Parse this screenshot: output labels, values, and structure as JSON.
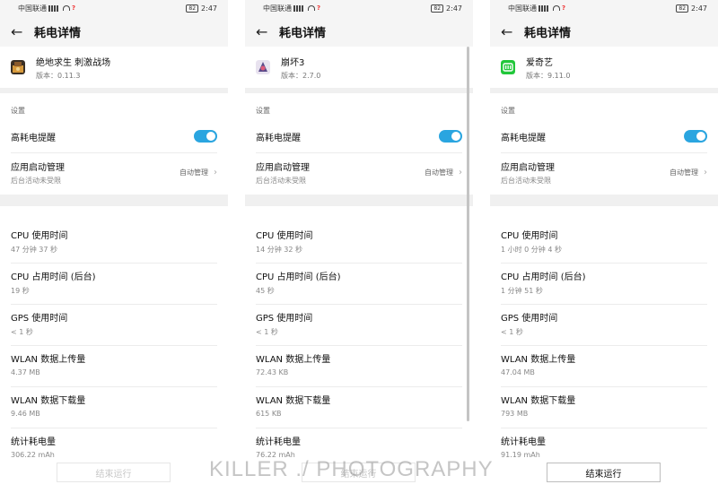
{
  "status_bar": {
    "carrier": "中国联通",
    "alert": "?",
    "battery": "82",
    "time": "2:47"
  },
  "header": {
    "title": "耗电详情"
  },
  "settings": {
    "section_label": "设置",
    "high_power_alert_label": "高耗电提醒",
    "high_power_alert_on": true,
    "launch_mgmt_label": "应用启动管理",
    "launch_mgmt_sub": "后台活动未受限",
    "launch_mgmt_value": "自动管理"
  },
  "stat_labels": [
    "CPU 使用时间",
    "CPU 占用时间 (后台)",
    "GPS 使用时间",
    "WLAN 数据上传量",
    "WLAN 数据下载量",
    "统计耗电量"
  ],
  "panels": [
    {
      "app_name": "绝地求生 刺激战场",
      "app_version": "版本：0.11.3",
      "stats": [
        "47 分钟 37 秒",
        "19 秒",
        "< 1 秒",
        "4.37 MB",
        "9.46 MB",
        "306.22 mAh"
      ],
      "end_button_label": "结束运行",
      "end_button_enabled": false
    },
    {
      "app_name": "崩坏3",
      "app_version": "版本：2.7.0",
      "stats": [
        "14 分钟 32 秒",
        "45 秒",
        "< 1 秒",
        "72.43 KB",
        "615 KB",
        "76.22 mAh"
      ],
      "end_button_label": "结束运行",
      "end_button_enabled": false
    },
    {
      "app_name": "爱奇艺",
      "app_version": "版本：9.11.0",
      "stats": [
        "1 小时 0 分钟 4 秒",
        "1 分钟 51 秒",
        "< 1 秒",
        "47.04 MB",
        "793 MB",
        "91.19 mAh"
      ],
      "end_button_label": "结束运行",
      "end_button_enabled": true
    }
  ],
  "watermark": "KILLER ./ PHOTOGRAPHY",
  "colors": {
    "accent": "#2aa5e0",
    "background": "#ffffff",
    "separator": "#f0f0f0",
    "iqiyi_green": "#21c73a"
  }
}
